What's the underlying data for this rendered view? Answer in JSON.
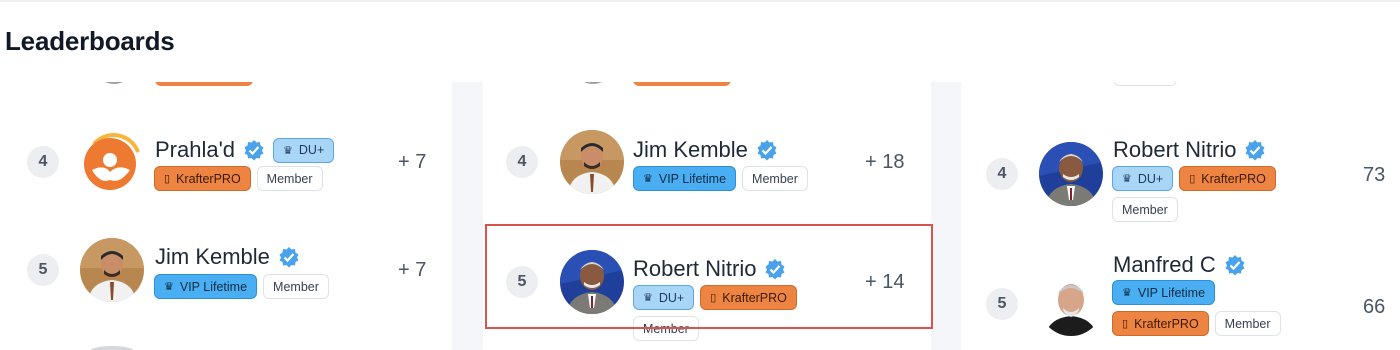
{
  "page": {
    "title": "Leaderboards"
  },
  "badges": {
    "du": "DU+",
    "vip": "VIP Lifetime",
    "krafter": "KrafterPRO",
    "member": "Member"
  },
  "icons": {
    "du": "crown-icon",
    "vip": "crown-icon",
    "krafter": "mouse-icon",
    "verified": "verified-check-icon"
  },
  "colors": {
    "highlight": "#d9534f",
    "verified": "#4aa3ea",
    "krafter": "#ee8441",
    "vip": "#4aaef2",
    "du": "#a9d5f7"
  },
  "columns": [
    {
      "rows": [
        {
          "rank": "4",
          "name": "Prahla'd",
          "score": "+ 7"
        },
        {
          "rank": "5",
          "name": "Jim Kemble",
          "score": "+ 7"
        }
      ]
    },
    {
      "rows": [
        {
          "rank": "4",
          "name": "Jim Kemble",
          "score": "+ 18"
        },
        {
          "rank": "5",
          "name": "Robert Nitrio",
          "score": "+ 14",
          "highlighted": true
        }
      ]
    },
    {
      "rows": [
        {
          "rank": "4",
          "name": "Robert Nitrio",
          "score": "73"
        },
        {
          "rank": "5",
          "name": "Manfred C",
          "score": "66"
        }
      ]
    }
  ]
}
